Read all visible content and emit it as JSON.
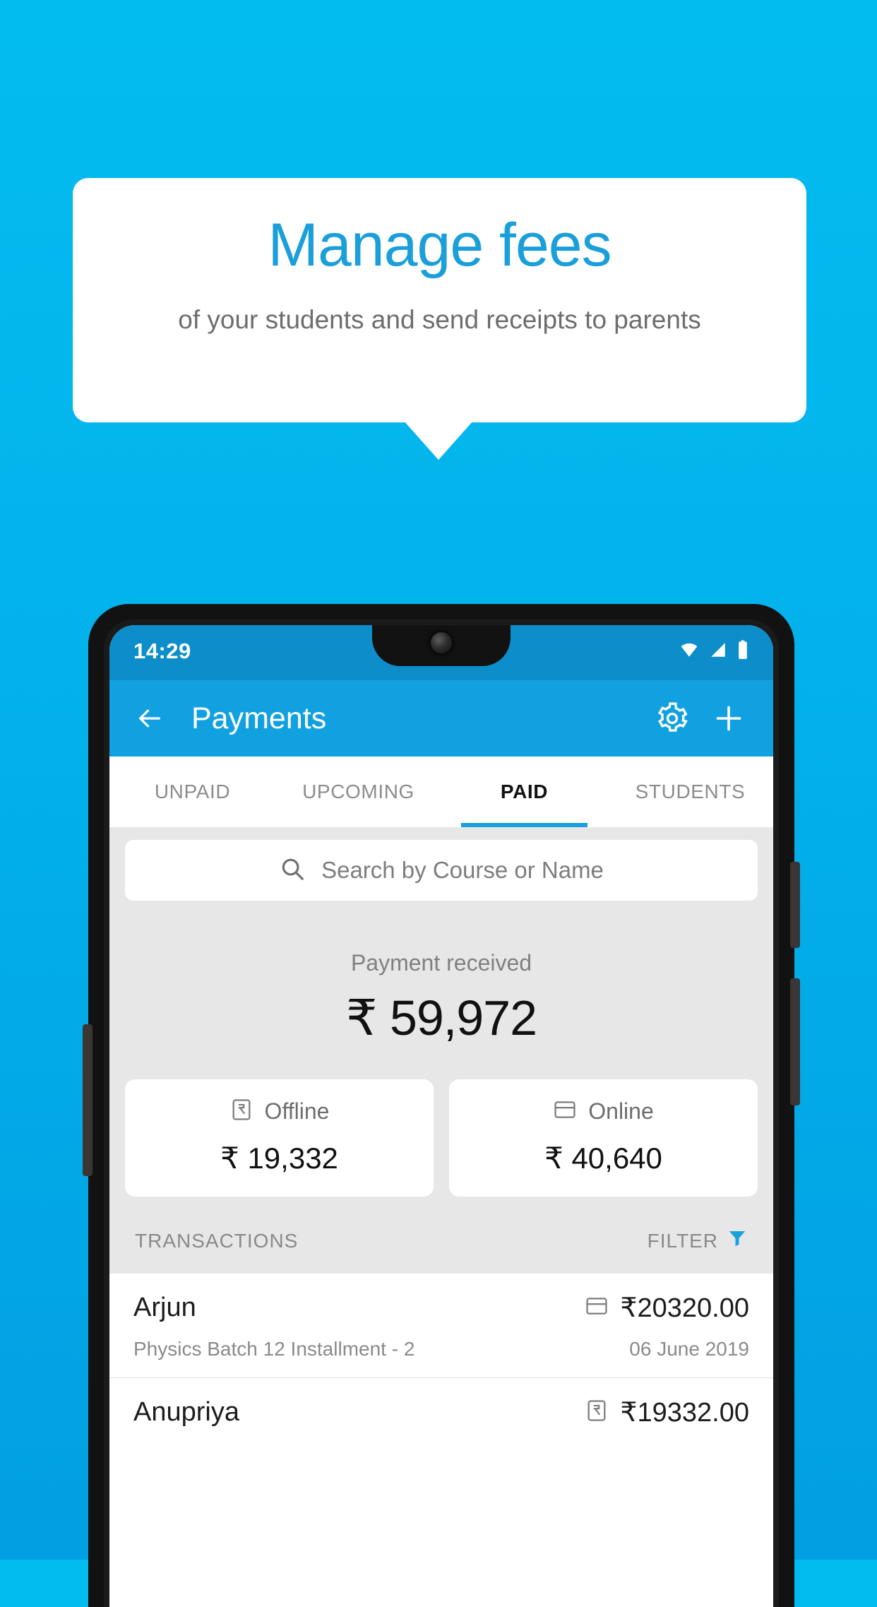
{
  "promo": {
    "title": "Manage fees",
    "subtitle": "of your students and send receipts to parents",
    "title_color": "#1a9fd9",
    "subtitle_color": "#6d6d6d",
    "background_color": "#03bcef"
  },
  "status_bar": {
    "time": "14:29",
    "icons": [
      "wifi-icon",
      "signal-icon",
      "battery-icon"
    ]
  },
  "app_bar": {
    "title": "Payments",
    "back_icon": "back-arrow-icon",
    "settings_icon": "gear-icon",
    "add_icon": "plus-icon",
    "color": "#12a1e0"
  },
  "tabs": [
    {
      "label": "UNPAID",
      "active": false
    },
    {
      "label": "UPCOMING",
      "active": false
    },
    {
      "label": "PAID",
      "active": true
    },
    {
      "label": "STUDENTS",
      "active": false
    }
  ],
  "search": {
    "placeholder": "Search by Course or Name",
    "icon": "search-icon"
  },
  "summary": {
    "label": "Payment received",
    "amount": "₹ 59,972"
  },
  "method_cards": [
    {
      "label": "Offline",
      "amount": "₹ 19,332",
      "icon": "rupee-note-icon"
    },
    {
      "label": "Online",
      "amount": "₹ 40,640",
      "icon": "credit-card-icon"
    }
  ],
  "list_header": {
    "title": "TRANSACTIONS",
    "filter_label": "FILTER",
    "filter_icon": "funnel-icon",
    "filter_color": "#19a2dd"
  },
  "transactions": [
    {
      "name": "Arjun",
      "amount": "₹20320.00",
      "method_icon": "credit-card-icon",
      "description": "Physics Batch 12 Installment - 2",
      "date": "06 June 2019"
    },
    {
      "name": "Anupriya",
      "amount": "₹19332.00",
      "method_icon": "rupee-note-icon",
      "description": "",
      "date": ""
    }
  ]
}
